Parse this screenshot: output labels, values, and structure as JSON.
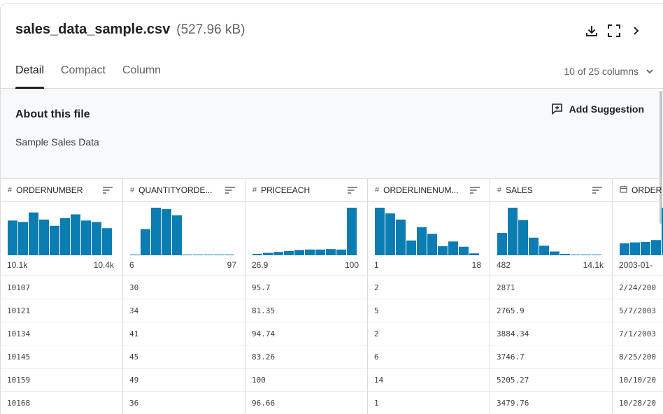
{
  "file": {
    "name": "sales_data_sample.csv",
    "size": "(527.96 kB)"
  },
  "header_icons": [
    "download-icon",
    "fullscreen-icon",
    "chevron-right-icon"
  ],
  "tabs": [
    {
      "label": "Detail",
      "active": true
    },
    {
      "label": "Compact",
      "active": false
    },
    {
      "label": "Column",
      "active": false
    }
  ],
  "columns_selector": "10 of 25 columns",
  "about": {
    "title": "About this file",
    "description": "Sample Sales Data",
    "suggest_label": "Add Suggestion"
  },
  "accent_color": "#0b7db2",
  "grid": {
    "columns": [
      {
        "type_icon": "#",
        "name": "ORDERNUMBER",
        "hist_min": "10.1k",
        "hist_max": "10.4k",
        "hist": [
          0.73,
          0.7,
          0.9,
          0.75,
          0.62,
          0.78,
          0.86,
          0.73,
          0.7,
          0.57
        ],
        "values": [
          "10107",
          "10121",
          "10134",
          "10145",
          "10159",
          "10168"
        ]
      },
      {
        "type_icon": "#",
        "name": "QUANTITYORDE...",
        "hist_min": "6",
        "hist_max": "97",
        "hist": [
          0.01,
          0.55,
          1.0,
          0.97,
          0.84,
          0.02,
          0.01,
          0.0,
          0.0,
          0.0
        ],
        "values": [
          "30",
          "34",
          "41",
          "45",
          "49",
          "36"
        ]
      },
      {
        "type_icon": "#",
        "name": "PRICEEACH",
        "hist_min": "26.9",
        "hist_max": "100",
        "hist": [
          0.03,
          0.05,
          0.07,
          0.09,
          0.11,
          0.12,
          0.12,
          0.13,
          0.12,
          1.0
        ],
        "values": [
          "95.7",
          "81.35",
          "94.74",
          "83.26",
          "100",
          "96.66"
        ]
      },
      {
        "type_icon": "#",
        "name": "ORDERLINENUM...",
        "hist_min": "1",
        "hist_max": "18",
        "hist": [
          1.0,
          0.88,
          0.75,
          0.31,
          0.59,
          0.45,
          0.19,
          0.29,
          0.18,
          0.04
        ],
        "values": [
          "2",
          "5",
          "2",
          "6",
          "14",
          "1"
        ]
      },
      {
        "type_icon": "#",
        "name": "SALES",
        "hist_min": "482",
        "hist_max": "14.1k",
        "hist": [
          0.47,
          1.0,
          0.74,
          0.37,
          0.2,
          0.08,
          0.03,
          0.01,
          0.01,
          0.0
        ],
        "values": [
          "2871",
          "2765.9",
          "3884.34",
          "3746.7",
          "5205.27",
          "3479.76"
        ]
      },
      {
        "type_icon": "calendar",
        "name": "ORDER",
        "hist_min": "2003-01-",
        "hist_max": "",
        "hist": [
          0.25,
          0.27,
          0.28,
          0.32,
          1.0,
          0.3
        ],
        "values": [
          "2/24/200",
          "5/7/2003",
          "7/1/2003",
          "8/25/200",
          "10/10/20",
          "10/28/20"
        ]
      }
    ]
  }
}
